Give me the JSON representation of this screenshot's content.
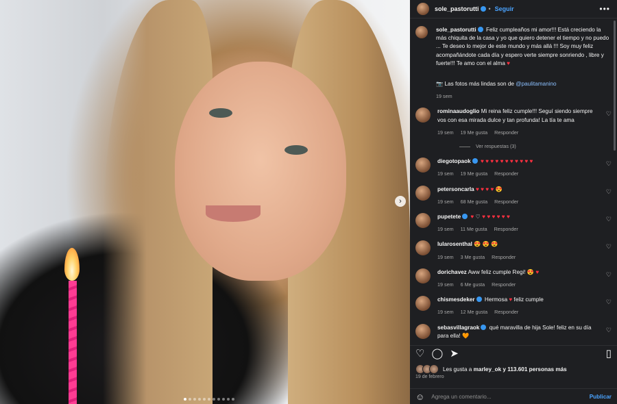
{
  "post": {
    "username": "sole_pastorutti",
    "follow_label": "Seguir",
    "more_label": "•••",
    "caption": "Feliz cumpleaños mi amor!!! Está creciendo la más chiquita de la casa y yo que quiero detener el tiempo y no puedo ... Te deseo lo mejor de este mundo y más allá !!! Soy muy feliz acompañándote cada día y espero verte siempre sonriendo , libre y fuerte!!! Te amo con el alma",
    "photo_credit_prefix": "Las fotos más lindas son de",
    "photo_credit_user": "@paulitamanino",
    "caption_time": "19 sem",
    "likes_prefix": "Les gusta a",
    "likes_user": "marley_ok",
    "likes_suffix": "y 113.601 personas más",
    "date": "19 de febrero",
    "comment_placeholder": "Agrega un comentario...",
    "publish_label": "Publicar"
  },
  "comments": [
    {
      "user": "rominaaudoglio",
      "verified": false,
      "text": "Mi reina feliz cumple!!! Seguí siendo siempre vos con esa mirada dulce y tan profunda! La tía te ama",
      "time": "19 sem",
      "likes": "19 Me gusta",
      "reply": "Responder",
      "view_replies": "Ver respuestas (3)"
    },
    {
      "user": "diegotopaok",
      "verified": true,
      "text": "♥ ♥ ♥ ♥ ♥ ♥ ♥ ♥ ♥ ♥ ♥",
      "time": "19 sem",
      "likes": "19 Me gusta",
      "reply": "Responder"
    },
    {
      "user": "petersoncarla",
      "verified": false,
      "text": "♥ ♥ ♥ ♥ 😍",
      "time": "19 sem",
      "likes": "68 Me gusta",
      "reply": "Responder"
    },
    {
      "user": "pupetete",
      "verified": true,
      "text": "♥ ♡ ♥ ♥ ♥ ♥ ♥ ♥",
      "time": "19 sem",
      "likes": "11 Me gusta",
      "reply": "Responder"
    },
    {
      "user": "lularosenthal",
      "verified": false,
      "text": "😍 😍 😍",
      "time": "19 sem",
      "likes": "3 Me gusta",
      "reply": "Responder"
    },
    {
      "user": "dorichavez",
      "verified": false,
      "text": "Aww feliz cumple Regi! 😍 ♥",
      "time": "19 sem",
      "likes": "6 Me gusta",
      "reply": "Responder"
    },
    {
      "user": "chismesdeker",
      "verified": true,
      "text": "Hermosa ♥ feliz cumple",
      "time": "19 sem",
      "likes": "12 Me gusta",
      "reply": "Responder"
    },
    {
      "user": "sebasvillagraok",
      "verified": true,
      "text": "qué maravilla de hija Sole! feliz en su día para ella! 🧡",
      "time": "",
      "likes": "",
      "reply": ""
    }
  ],
  "colors": {
    "accent": "#4aa3ff",
    "heart": "#ff3040",
    "panel": "#1e1f22"
  },
  "icons": [
    "heart-icon",
    "comment-icon",
    "share-icon",
    "bookmark-icon",
    "emoji-icon",
    "more-icon",
    "next-arrow-icon",
    "verified-icon"
  ]
}
